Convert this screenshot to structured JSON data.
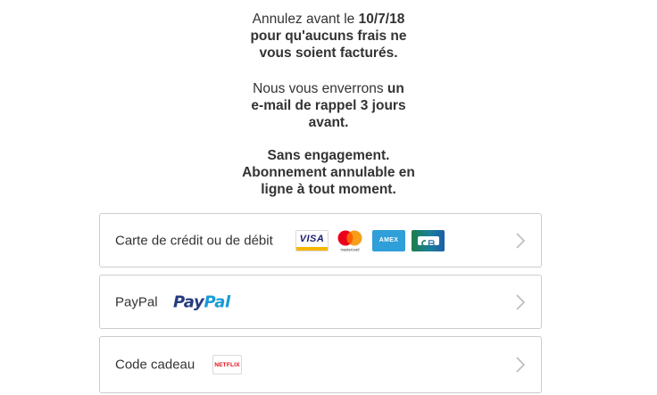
{
  "notice": {
    "cancel": {
      "prefix": "Annulez avant le ",
      "date": "10/7/18",
      "line2": "pour qu'aucuns frais ne",
      "line3": "vous soient facturés."
    },
    "reminder": {
      "prefix": "Nous vous enverrons ",
      "bold1": "un",
      "line2": "e-mail de rappel 3 jours",
      "line3": "avant."
    },
    "commitment": {
      "line1": "Sans engagement.",
      "line2": "Abonnement annulable en",
      "line3": "ligne à tout moment."
    }
  },
  "payment_options": {
    "card": {
      "label": "Carte de crédit ou de débit",
      "logos": {
        "visa": "VISA",
        "mastercard": "mastercard",
        "amex": "AMEX"
      }
    },
    "paypal": {
      "label": "PayPal",
      "logo_pay": "Pay",
      "logo_pal": "Pal"
    },
    "gift": {
      "label": "Code cadeau",
      "logo": "NETFLIX"
    }
  },
  "colors": {
    "text": "#333333",
    "border": "#cccccc",
    "chevron": "#bbbbbb",
    "netflix_red": "#e50914",
    "paypal_dark": "#253b80",
    "paypal_light": "#179bd7"
  }
}
